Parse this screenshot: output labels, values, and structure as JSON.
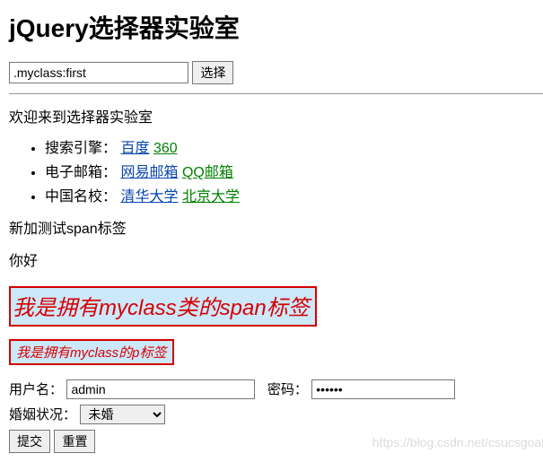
{
  "title": "jQuery选择器实验室",
  "selector": {
    "value": ".myclass:first",
    "button": "选择"
  },
  "welcome": "欢迎来到选择器实验室",
  "list": [
    {
      "label": "搜索引擎：",
      "link1": "百度",
      "link2": "360"
    },
    {
      "label": "电子邮箱：",
      "link1": "网易邮箱",
      "link2": "QQ邮箱"
    },
    {
      "label": "中国名校：",
      "link1": "清华大学",
      "link2": "北京大学"
    }
  ],
  "newSpanNote": "新加测试span标签",
  "hello": "你好",
  "highlightSpan": "我是拥有myclass类的span标签",
  "highlightP": "我是拥有myclass的p标签",
  "form": {
    "usernameLabel": "用户名：",
    "usernameValue": "admin",
    "passwordLabel": "密码：",
    "passwordValue": "••••••",
    "maritalLabel": "婚姻状况：",
    "maritalValue": "未婚",
    "submit": "提交",
    "reset": "重置"
  },
  "watermark": "https://blog.csdn.net/csucsgoat"
}
